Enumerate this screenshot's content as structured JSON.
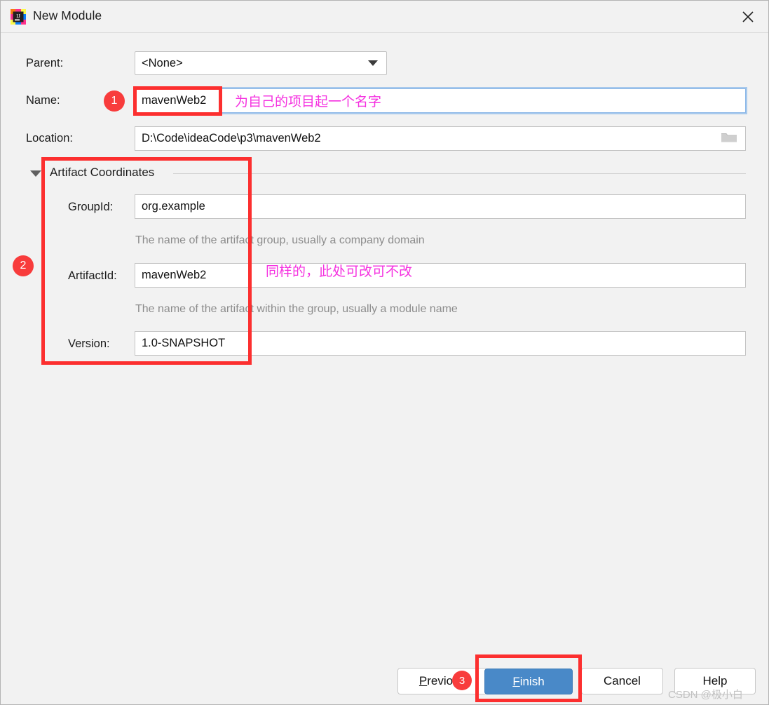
{
  "window": {
    "title": "New Module",
    "icon": "intellij-idea-logo",
    "close_icon": "close-icon"
  },
  "form": {
    "parent": {
      "label": "Parent:",
      "value": "<None>",
      "caret_icon": "chevron-down-icon"
    },
    "name": {
      "label": "Name:",
      "value": "mavenWeb2",
      "focused": true
    },
    "location": {
      "label": "Location:",
      "value": "D:\\Code\\ideaCode\\p3\\mavenWeb2",
      "browse_icon": "folder-icon"
    }
  },
  "artifact_coordinates": {
    "title": "Artifact Coordinates",
    "expander_icon": "triangle-down-icon",
    "group_id": {
      "label": "GroupId:",
      "value": "org.example",
      "help": "The name of the artifact group, usually a company domain"
    },
    "artifact_id": {
      "label": "ArtifactId:",
      "value": "mavenWeb2",
      "help": "The name of the artifact within the group, usually a module name"
    },
    "version": {
      "label": "Version:",
      "value": "1.0-SNAPSHOT"
    }
  },
  "annotations": {
    "badge_1": "1",
    "badge_2": "2",
    "badge_3": "3",
    "note_1": "为自己的项目起一个名字",
    "note_2": "同样的，此处可改可不改",
    "box_color": "#fc2f2f",
    "note_color": "#f531e0",
    "badge_color": "#f83c3c"
  },
  "footer": {
    "previous": {
      "mnemonic": "P",
      "rest": "revious"
    },
    "finish": {
      "mnemonic": "F",
      "rest": "inish"
    },
    "cancel": "Cancel",
    "help": "Help"
  },
  "watermark": "CSDN @极小白"
}
